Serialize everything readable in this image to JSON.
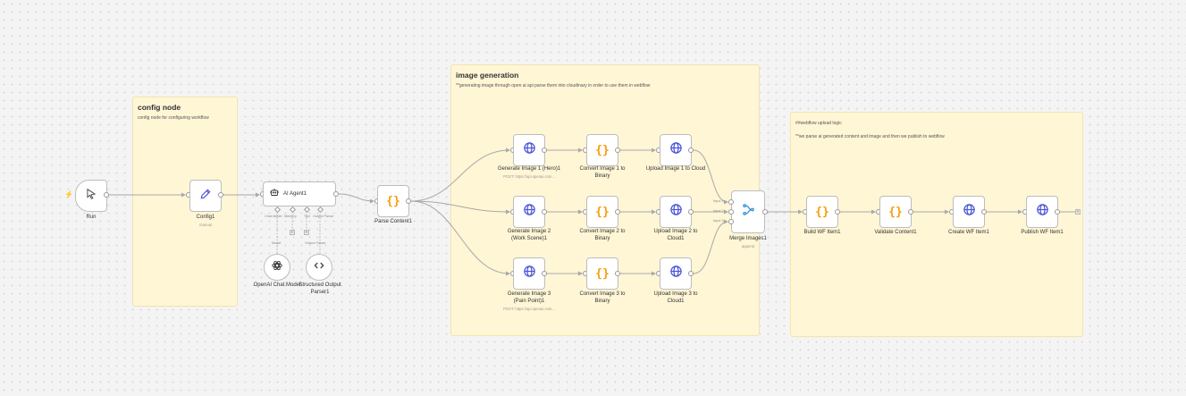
{
  "canvas": {
    "accent": "#ff6d3a",
    "edge_color": "#a8a8a8",
    "node_icon_blue": "#4a54d6",
    "code_icon_orange": "#f59e0b"
  },
  "stickies": {
    "config": {
      "title": "config node",
      "text": "config node for configuring workflow"
    },
    "image": {
      "title": "image generation",
      "text": "**generating image through open ai api parse them into cloudinary in order to use them in webflow"
    },
    "webflow": {
      "line1": "##webflow upload logic",
      "line2": "**we parse ai generated content and image and then we publish to webflow"
    }
  },
  "nodes": {
    "run": {
      "label": "Run",
      "icon": "cursor-icon"
    },
    "config": {
      "label": "Config1",
      "sub": "manual",
      "icon": "pencil-icon"
    },
    "agent": {
      "label": "AI Agent1",
      "icon": "robot-icon",
      "ports": {
        "chat_model": "Chat Model",
        "memory": "Memory",
        "tool": "Tool",
        "output_parser": "Output Parser"
      }
    },
    "openai_chat": {
      "label": "OpenAI Chat Model",
      "port": "Model",
      "icon": "openai-icon"
    },
    "output_parser": {
      "label": "Structured Output Parser1",
      "port": "Output Parser",
      "icon": "code-brackets-icon"
    },
    "parse": {
      "label": "Parse Content1",
      "icon": "braces-icon"
    },
    "gen1": {
      "label": "Generate Image 1 (Hero)1",
      "sub": "POST: https://api.openai.com...",
      "icon": "globe-icon"
    },
    "conv1": {
      "label": "Convert Image 1 to Binary",
      "icon": "braces-icon"
    },
    "up1": {
      "label": "Upload Image 1 to Cloud",
      "icon": "globe-icon"
    },
    "gen2": {
      "label": "Generate Image 2 (Work Scene)1",
      "icon": "globe-icon"
    },
    "conv2": {
      "label": "Convert Image 2 to Binary",
      "icon": "braces-icon"
    },
    "up2": {
      "label": "Upload Image 2 to Cloud1",
      "icon": "globe-icon"
    },
    "gen3": {
      "label": "Generate Image 3 (Pain Point)1",
      "sub": "POST: https://api.openai.com...",
      "icon": "globe-icon"
    },
    "conv3": {
      "label": "Convert Image 3 to Binary",
      "icon": "braces-icon"
    },
    "up3": {
      "label": "Upload Image 3 to Cloud1",
      "icon": "globe-icon"
    },
    "merge": {
      "label": "Merge Images1",
      "sub": "append",
      "icon": "merge-icon",
      "inputs": [
        "Input 1",
        "Input 2",
        "Input 3"
      ]
    },
    "build": {
      "label": "Build WF Item1",
      "icon": "braces-icon"
    },
    "validate": {
      "label": "Validate Content1",
      "icon": "braces-icon"
    },
    "create": {
      "label": "Create WF Item1",
      "icon": "globe-icon"
    },
    "publish": {
      "label": "Publish WF Item1",
      "icon": "globe-icon"
    }
  }
}
